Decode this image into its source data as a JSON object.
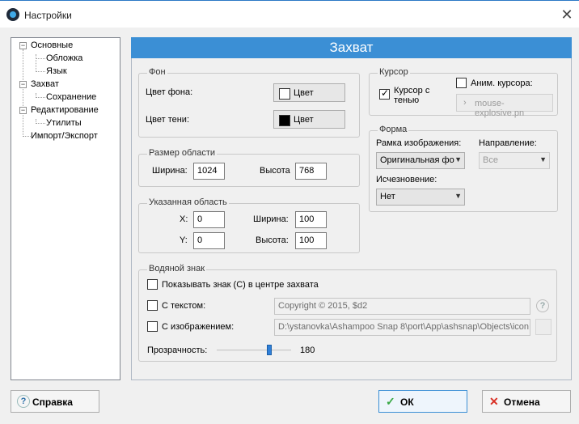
{
  "window": {
    "title": "Настройки",
    "close_icon": "close-icon"
  },
  "tree": {
    "items": [
      {
        "label": "Основные",
        "level": 0
      },
      {
        "label": "Обложка",
        "level": 1
      },
      {
        "label": "Язык",
        "level": 1
      },
      {
        "label": "Захват",
        "level": 0
      },
      {
        "label": "Сохранение",
        "level": 1
      },
      {
        "label": "Редактирование",
        "level": 0
      },
      {
        "label": "Утилиты",
        "level": 1
      },
      {
        "label": "Импорт/Экспорт",
        "level": 0
      }
    ]
  },
  "panel": {
    "title": "Захват"
  },
  "background": {
    "title": "Фон",
    "bg_color_label": "Цвет фона:",
    "bg_color_button": "Цвет",
    "bg_color_value": "#ffffff",
    "shadow_color_label": "Цвет тени:",
    "shadow_color_button": "Цвет",
    "shadow_color_value": "#000000"
  },
  "area_size": {
    "title": "Размер области",
    "width_label": "Ширина:",
    "width_value": "1024",
    "height_label": "Высота",
    "height_value": "768"
  },
  "specified_area": {
    "title": "Указанная область",
    "x_label": "X:",
    "x_value": "0",
    "y_label": "Y:",
    "y_value": "0",
    "width_label": "Ширина:",
    "width_value": "100",
    "height_label": "Высота:",
    "height_value": "100"
  },
  "cursor": {
    "title": "Курсор",
    "shadow_check_label_1": "Курсор с",
    "shadow_check_label_2": "тенью",
    "shadow_checked": true,
    "anim_label": "Аним. курсора:",
    "anim_checked": false,
    "anim_file": "mouse-explosive.pn"
  },
  "shape": {
    "title": "Форма",
    "frame_label": "Рамка изображения:",
    "frame_value": "Оригинальная фо",
    "direction_label": "Направление:",
    "direction_value": "Все",
    "fade_label": "Исчезновение:",
    "fade_value": "Нет"
  },
  "watermark": {
    "title": "Водяной знак",
    "show_label": "Показывать знак (C) в центре захвата",
    "text_label": "С текстом:",
    "text_value": "Copyright © 2015, $d2",
    "image_label": "С изображением:",
    "image_value": "D:\\ystanovka\\Ashampoo Snap 8\\port\\App\\ashsnap\\Objects\\icon",
    "opacity_label": "Прозрачность:",
    "opacity_value": "180",
    "opacity_max": 255
  },
  "footer": {
    "help_label": "Справка",
    "ok_label": "ОК",
    "cancel_label": "Отмена"
  },
  "colors": {
    "accent": "#3b8fd5",
    "ok_check": "#39a845",
    "cancel_x": "#d93025"
  }
}
